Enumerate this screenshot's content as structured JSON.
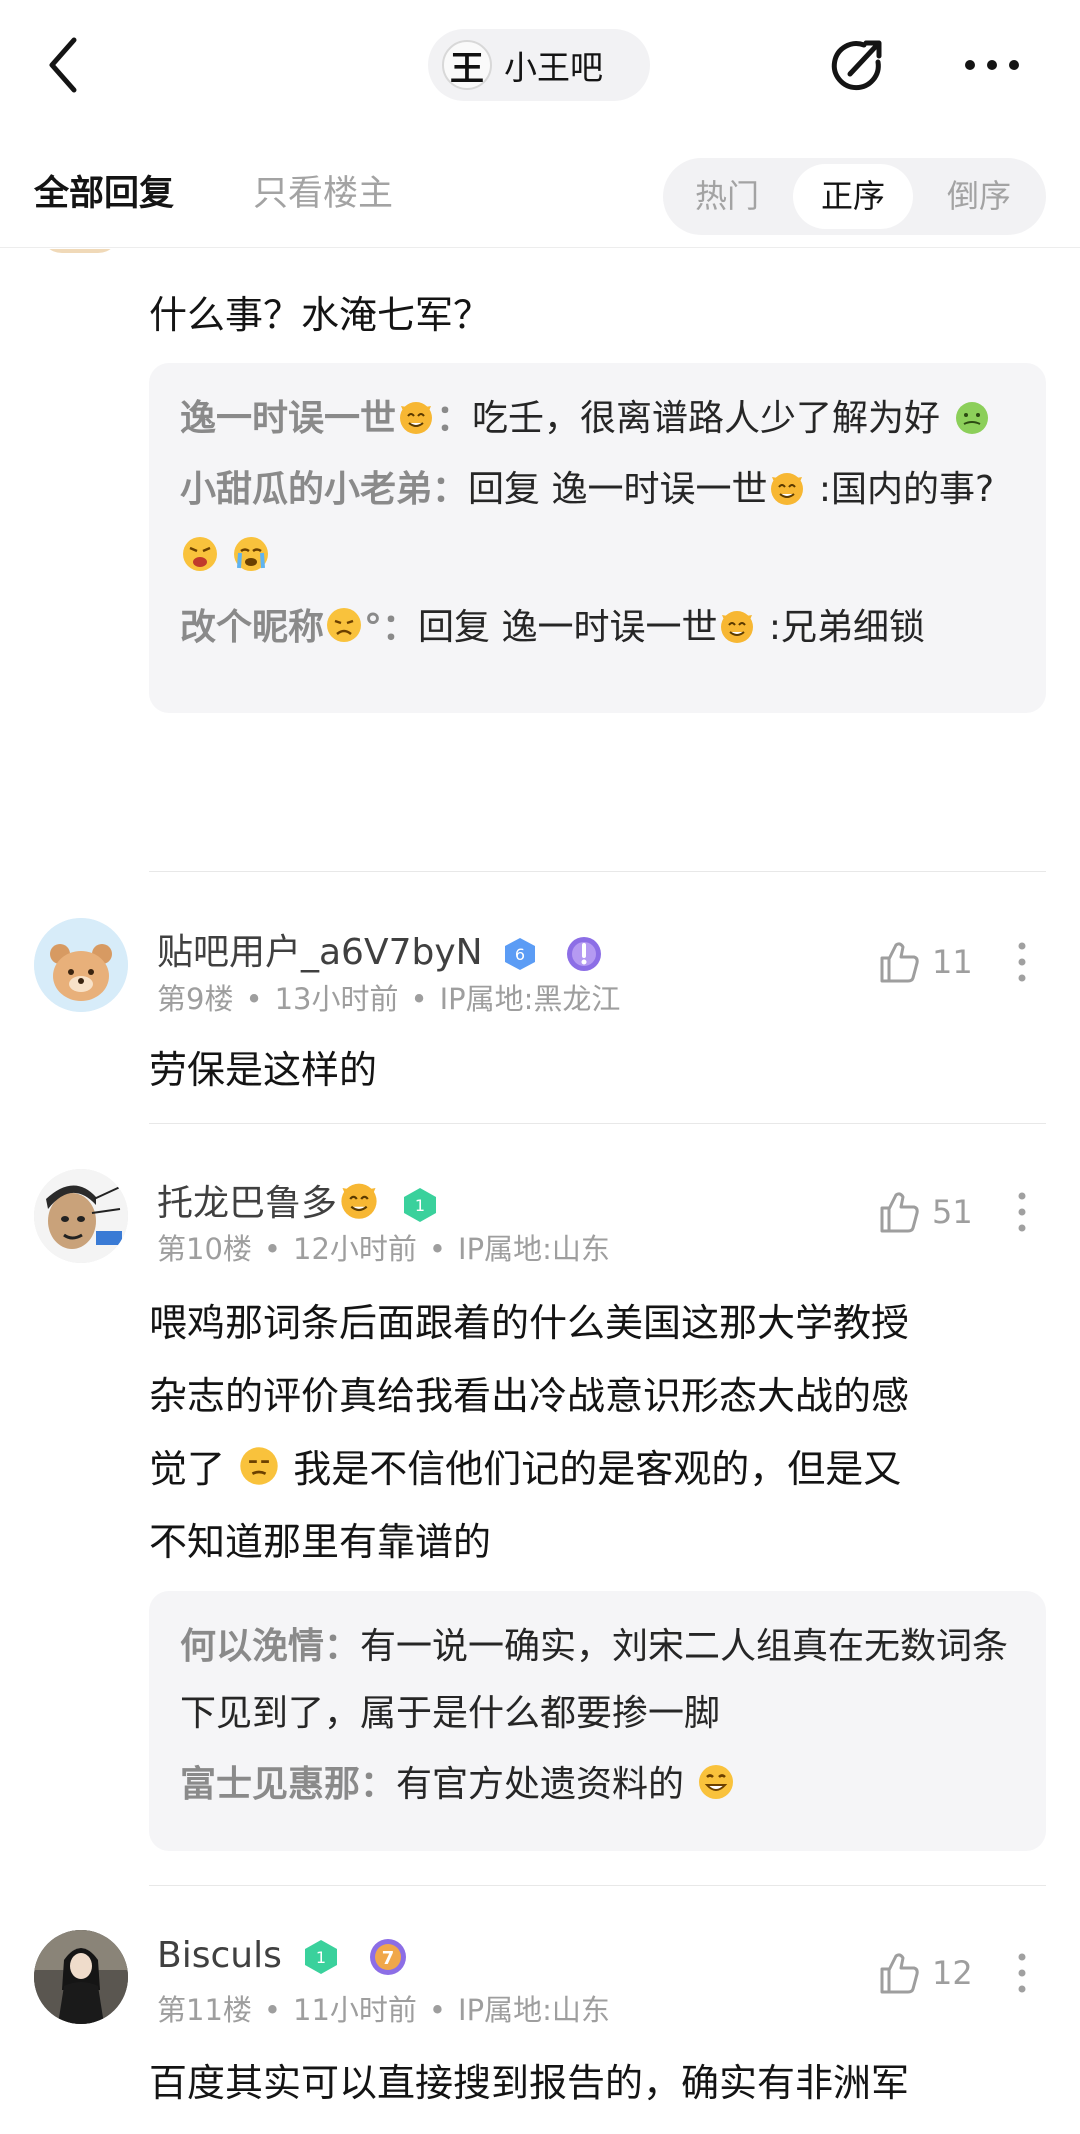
{
  "header": {
    "forum_name": "小王吧",
    "forum_logo_glyph": "王"
  },
  "tabs": {
    "all_replies": "全部回复",
    "host_only": "只看楼主",
    "sort_hot": "热门",
    "sort_asc": "正序",
    "sort_desc": "倒序",
    "active_sort": "正序"
  },
  "post8": {
    "body": "什么事？水淹七军？",
    "replies": [
      {
        "author": "逸一时误一世",
        "author_emoji": "cat-emoji",
        "sep": "：",
        "text": "吃壬，很离谱路人少了解为好",
        "trail_emoji": "sick-emoji"
      },
      {
        "author": "小甜瓜的小老弟",
        "sep": "：",
        "prefix": "回复 逸一时误一世",
        "prefix_emoji": "cat-emoji",
        "text": " :国内的事?",
        "trail_emoji": "scream-emoji",
        "trail_emoji2": "sob-emoji"
      },
      {
        "author": "改个昵称",
        "author_emoji": "sad-emoji",
        "author_suffix": "°",
        "sep": "：",
        "prefix": "回复 逸一时误一世",
        "prefix_emoji": "cat-emoji",
        "text": " :兄弟细锁"
      }
    ]
  },
  "post9": {
    "username": "贴吧用户_a6V7byN",
    "level_badge": "6",
    "floor": "第9楼",
    "time": "13小时前",
    "ip": "IP属地:黑龙江",
    "likes": "11",
    "body": "劳保是这样的"
  },
  "post10": {
    "username": "托龙巴鲁多",
    "level_badge": "1",
    "floor": "第10楼",
    "time": "12小时前",
    "ip": "IP属地:山东",
    "likes": "51",
    "body_line1": "喂鸡那词条后面跟着的什么美国这那大学教授",
    "body_line2": "杂志的评价真给我看出冷战意识形态大战的感",
    "body_line3a": "觉了",
    "body_line3b": "我是不信他们记的是客观的，但是又",
    "body_line4": "不知道那里有靠谱的",
    "replies": [
      {
        "author": "何以浼情",
        "sep": "：",
        "text": "有一说一确实，刘宋二人组真在无数词条下见到了，属于是什么都要掺一脚"
      },
      {
        "author": "富士见惠那",
        "sep": "：",
        "text": "有官方处遗资料的"
      }
    ]
  },
  "post11": {
    "username": "Bisculs",
    "level_badge": "1",
    "member_badge": "7",
    "floor": "第11楼",
    "time": "11小时前",
    "ip": "IP属地:山东",
    "likes": "12",
    "body": "百度其实可以直接搜到报告的，确实有非洲军"
  },
  "meta_separator": "•",
  "colors": {
    "accent_text": "#141414",
    "muted_text": "#9e9e9e",
    "reply_bg": "#f5f5f7",
    "level_blue": "#5b9cf5",
    "level_green": "#3ad19c",
    "member_purple": "#8c6ee6"
  }
}
